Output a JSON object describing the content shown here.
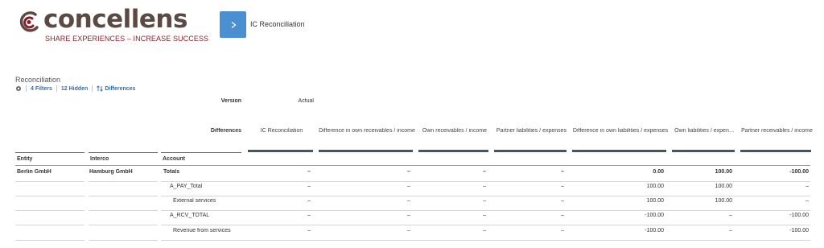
{
  "header": {
    "logo_word": "concellens",
    "logo_tagline": "SHARE EXPERIENCES – INCREASE SUCCESS",
    "story_title": "IC Reconciliation"
  },
  "widget": {
    "title": "Reconciliation",
    "filters_label": "4 Filters",
    "hidden_label": "12 Hidden",
    "sort_label": "Differences"
  },
  "table": {
    "version_label": "Version",
    "version_value": "Actual",
    "differences_label": "Differences",
    "dimension_headers": [
      "Entity",
      "Interco",
      "Account"
    ],
    "columns": [
      "IC Reconciliation",
      "Difference in own receivables / income",
      "Own receivables / income",
      "Partner liabilities / expenses",
      "Difference in own liabilities / expenses",
      "Own liabilities / expen…",
      "Partner receivables / income"
    ],
    "rows": [
      {
        "entity": "Berlin GmbH",
        "interco": "Hamburg GmbH",
        "account": "Totals",
        "values": [
          "–",
          "–",
          "–",
          "–",
          "0.00",
          "100.00",
          "-100.00"
        ],
        "bold": true
      },
      {
        "entity": "",
        "interco": "",
        "account": "A_PAY_Total",
        "values": [
          "–",
          "–",
          "–",
          "–",
          "100.00",
          "100.00",
          "–"
        ],
        "bold": false
      },
      {
        "entity": "",
        "interco": "",
        "account": "External services",
        "values": [
          "–",
          "–",
          "–",
          "–",
          "100.00",
          "100.00",
          "–"
        ],
        "bold": false
      },
      {
        "entity": "",
        "interco": "",
        "account": "A_RCV_TOTAL",
        "values": [
          "–",
          "–",
          "–",
          "–",
          "-100.00",
          "–",
          "-100.00"
        ],
        "bold": false
      },
      {
        "entity": "",
        "interco": "",
        "account": "Revenue from services",
        "values": [
          "–",
          "–",
          "–",
          "–",
          "-100.00",
          "–",
          "-100.00"
        ],
        "bold": false
      }
    ]
  },
  "colors": {
    "accent": "#4a8fcf",
    "logo_text": "#5a4a42",
    "logo_tagline": "#8b1e2b",
    "link": "#2f6fa8"
  }
}
